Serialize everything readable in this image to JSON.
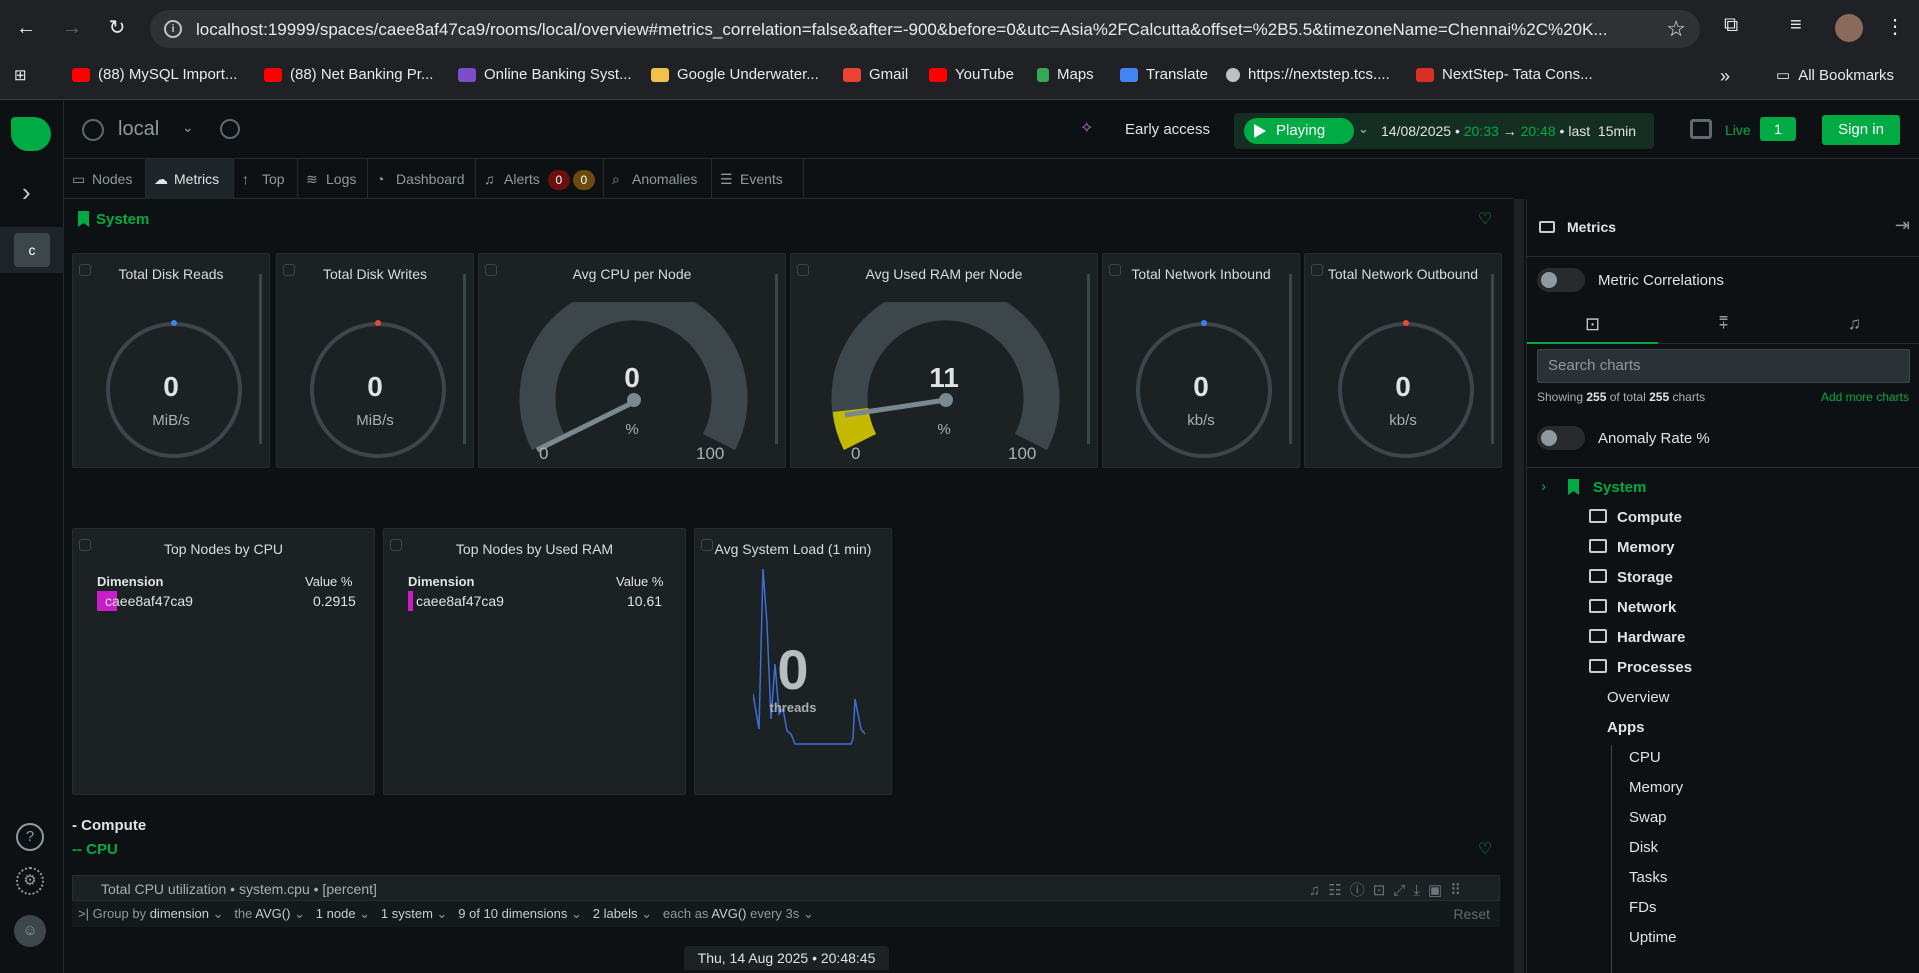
{
  "browser": {
    "url": "localhost:19999/spaces/caee8af47ca9/rooms/local/overview#metrics_correlation=false&after=-900&before=0&utc=Asia%2FCalcutta&offset=%2B5.5&timezoneName=Chennai%2C%20K...",
    "bookmarks": [
      {
        "label": "(88) MySQL Import...",
        "color": "#ff0000"
      },
      {
        "label": "(88) Net Banking Pr...",
        "color": "#ff0000"
      },
      {
        "label": "Online Banking Syst...",
        "color": "#7b4fc9"
      },
      {
        "label": "Google Underwater...",
        "color": "#f0c24b"
      },
      {
        "label": "Gmail",
        "color": "#ea4335"
      },
      {
        "label": "YouTube",
        "color": "#ff0000"
      },
      {
        "label": "Maps",
        "color": "#34a853"
      },
      {
        "label": "Translate",
        "color": "#4285f4"
      },
      {
        "label": "https://nextstep.tcs....",
        "color": "#bdc1c6"
      },
      {
        "label": "NextStep- Tata Cons...",
        "color": "#d93025"
      }
    ],
    "more_bookmarks": "»",
    "all_bookmarks": "All Bookmarks"
  },
  "rail": {
    "space_letter": "c"
  },
  "topbar": {
    "room": "local",
    "early_access": "Early access",
    "playing": "Playing",
    "date": "14/08/2025",
    "time_from": "20:33",
    "arrow": "→",
    "time_to": "20:48",
    "last_label": "last",
    "duration": "15min",
    "live_label": "Live",
    "live_count": "1",
    "sign_in": "Sign in"
  },
  "tabs": [
    {
      "label": "Nodes",
      "icon": "nodes-icon"
    },
    {
      "label": "Metrics",
      "icon": "metrics-icon"
    },
    {
      "label": "Top",
      "icon": "top-icon"
    },
    {
      "label": "Logs",
      "icon": "logs-icon"
    },
    {
      "label": "Dashboard",
      "icon": "dashboard-icon"
    },
    {
      "label": "Alerts",
      "icon": "bell-icon"
    },
    {
      "label": "Anomalies",
      "icon": "anomalies-icon"
    },
    {
      "label": "Events",
      "icon": "events-icon"
    }
  ],
  "alerts": {
    "critical": "0",
    "warning": "0",
    "critical_color": "#6b0f0f",
    "warning_color": "#6b4a0f"
  },
  "main": {
    "system_title": "System",
    "gauges": [
      {
        "title": "Total Disk Reads",
        "value": "0",
        "unit": "MiB/s",
        "marker": "#3e82e6"
      },
      {
        "title": "Total Disk Writes",
        "value": "0",
        "unit": "MiB/s",
        "marker": "#e6493e"
      },
      {
        "title": "Avg CPU per Node",
        "value": "0",
        "unit": "%",
        "min": "0",
        "max": "100",
        "level": 0
      },
      {
        "title": "Avg Used RAM per Node",
        "value": "11",
        "unit": "%",
        "min": "0",
        "max": "100",
        "level": 0.11
      },
      {
        "title": "Total Network Inbound",
        "value": "0",
        "unit": "kb/s",
        "marker": "#3e82e6"
      },
      {
        "title": "Total Network Outbound",
        "value": "0",
        "unit": "kb/s",
        "marker": "#e6493e"
      }
    ],
    "top_cpu": {
      "title": "Top Nodes by CPU",
      "col_dim": "Dimension",
      "col_val": "Value %",
      "row_dim": "caee8af47ca9",
      "row_val": "0.2915"
    },
    "top_ram": {
      "title": "Top Nodes by Used RAM",
      "col_dim": "Dimension",
      "col_val": "Value %",
      "row_dim": "caee8af47ca9",
      "row_val": "10.61"
    },
    "load": {
      "title": "Avg System Load (1 min)",
      "value": "0",
      "unit": "threads"
    },
    "compute_label": "- Compute",
    "cpu_label": "-- CPU",
    "cpu_chart_title": "Total CPU utilization • system.cpu • [percent]",
    "cpu_controls": {
      "group_by": "Group by",
      "dimension": "dimension",
      "the": "the",
      "avg": "AVG()",
      "nodes": "1 node",
      "systems": "1 system",
      "dims": "9 of 10 dimensions",
      "labels": "2 labels",
      "each_as": "each as",
      "each_avg": "AVG()",
      "every": "every 3s",
      "reset": "Reset"
    },
    "time_strip": "Thu, 14 Aug 2025 • 20:48:45"
  },
  "right_panel": {
    "title": "Metrics",
    "metric_correlations": "Metric Correlations",
    "search_placeholder": "Search charts",
    "showing_prefix": "Showing",
    "showing_count": "255",
    "showing_mid": "of total",
    "showing_total": "255",
    "showing_suffix": "charts",
    "add_more": "Add more charts",
    "anomaly_rate": "Anomaly Rate %",
    "tree": {
      "system": "System",
      "groups": [
        "Compute",
        "Memory",
        "Storage",
        "Network",
        "Hardware",
        "Processes"
      ],
      "processes_children": {
        "overview": "Overview",
        "apps": "Apps",
        "apps_children": [
          "CPU",
          "Memory",
          "Swap",
          "Disk",
          "Tasks",
          "FDs",
          "Uptime"
        ]
      }
    }
  },
  "colors": {
    "accent": "#00ab44",
    "ram_fill": "#c4b800"
  }
}
